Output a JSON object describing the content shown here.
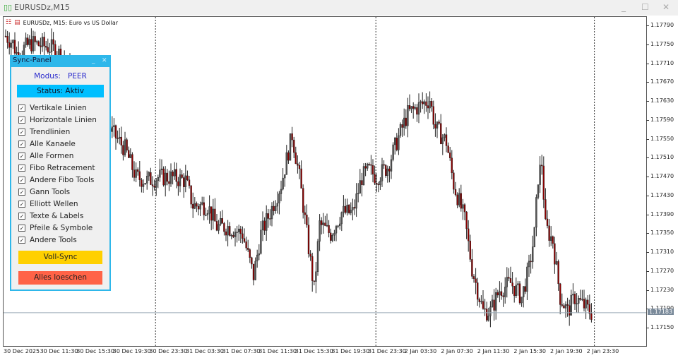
{
  "window": {
    "title": "EURUSDz,M15"
  },
  "chart": {
    "legend": "EURUSDz, M15:  Euro vs US Dollar",
    "current_price": "1.17183"
  },
  "panel": {
    "title": "Sync-Panel",
    "modus_label": "Modus:",
    "modus_value": "PEER",
    "status": "Status: Aktiv",
    "checkboxes": [
      {
        "label": "Vertikale Linien",
        "checked": true
      },
      {
        "label": "Horizontale Linien",
        "checked": true
      },
      {
        "label": "Trendlinien",
        "checked": true
      },
      {
        "label": "Alle Kanaele",
        "checked": true
      },
      {
        "label": "Alle Formen",
        "checked": true
      },
      {
        "label": "Fibo Retracement",
        "checked": true
      },
      {
        "label": "Andere Fibo Tools",
        "checked": true
      },
      {
        "label": "Gann Tools",
        "checked": true
      },
      {
        "label": "Elliott Wellen",
        "checked": true
      },
      {
        "label": "Texte & Labels",
        "checked": true
      },
      {
        "label": "Pfeile & Symbole",
        "checked": true
      },
      {
        "label": "Andere Tools",
        "checked": true
      }
    ],
    "full_sync": "Voll-Sync",
    "clear_all": "Alles loeschen",
    "colors": {
      "full_sync": "#ffd000",
      "clear_all": "#ff6347",
      "status": "#00bfff"
    }
  },
  "chart_data": {
    "type": "candlestick",
    "symbol": "EURUSDz",
    "timeframe": "M15",
    "ylim": [
      1.1712,
      1.1781
    ],
    "yticks": [
      "1.17790",
      "1.17750",
      "1.17710",
      "1.17670",
      "1.17630",
      "1.17590",
      "1.17550",
      "1.17510",
      "1.17470",
      "1.17430",
      "1.17390",
      "1.17350",
      "1.17310",
      "1.17270",
      "1.17230",
      "1.17190",
      "1.17150"
    ],
    "xticks": [
      "30 Dec 2025",
      "30 Dec 11:30",
      "30 Dec 15:30",
      "30 Dec 19:30",
      "30 Dec 23:30",
      "31 Dec 03:30",
      "31 Dec 07:30",
      "31 Dec 11:30",
      "31 Dec 15:30",
      "31 Dec 19:30",
      "31 Dec 23:30",
      "2 Jan 03:30",
      "2 Jan 07:30",
      "2 Jan 11:30",
      "2 Jan 15:30",
      "2 Jan 19:30",
      "2 Jan 23:30"
    ],
    "day_separators_bar": [
      82,
      202,
      321
    ],
    "bars_total": 320,
    "waypoints": [
      [
        0,
        1.17769
      ],
      [
        4,
        1.17754
      ],
      [
        6,
        1.17732
      ],
      [
        14,
        1.17754
      ],
      [
        22,
        1.17747
      ],
      [
        28,
        1.17739
      ],
      [
        40,
        1.1766
      ],
      [
        56,
        1.17575
      ],
      [
        65,
        1.1753
      ],
      [
        71,
        1.1747
      ],
      [
        77,
        1.17463
      ],
      [
        83,
        1.1747
      ],
      [
        90,
        1.1747
      ],
      [
        98,
        1.17463
      ],
      [
        102,
        1.1741
      ],
      [
        110,
        1.1741
      ],
      [
        115,
        1.17365
      ],
      [
        121,
        1.17365
      ],
      [
        129,
        1.1735
      ],
      [
        135,
        1.17261
      ],
      [
        139,
        1.1735
      ],
      [
        144,
        1.17395
      ],
      [
        150,
        1.17455
      ],
      [
        156,
        1.1756
      ],
      [
        160,
        1.1747
      ],
      [
        164,
        1.1735
      ],
      [
        168,
        1.17231
      ],
      [
        171,
        1.1737
      ],
      [
        177,
        1.1735
      ],
      [
        183,
        1.17395
      ],
      [
        189,
        1.17395
      ],
      [
        194,
        1.1747
      ],
      [
        198,
        1.17485
      ],
      [
        202,
        1.1747
      ],
      [
        208,
        1.17492
      ],
      [
        213,
        1.17545
      ],
      [
        219,
        1.17605
      ],
      [
        225,
        1.1762
      ],
      [
        231,
        1.17635
      ],
      [
        234,
        1.17575
      ],
      [
        240,
        1.17545
      ],
      [
        244,
        1.17455
      ],
      [
        250,
        1.1738
      ],
      [
        254,
        1.17276
      ],
      [
        260,
        1.17186
      ],
      [
        264,
        1.17186
      ],
      [
        269,
        1.17231
      ],
      [
        275,
        1.17246
      ],
      [
        281,
        1.17216
      ],
      [
        285,
        1.17276
      ],
      [
        288,
        1.1735
      ],
      [
        290,
        1.1747
      ],
      [
        292,
        1.175
      ],
      [
        294,
        1.17365
      ],
      [
        298,
        1.17335
      ],
      [
        302,
        1.17216
      ],
      [
        306,
        1.17186
      ],
      [
        310,
        1.17216
      ],
      [
        314,
        1.17201
      ],
      [
        319,
        1.17183
      ]
    ]
  }
}
